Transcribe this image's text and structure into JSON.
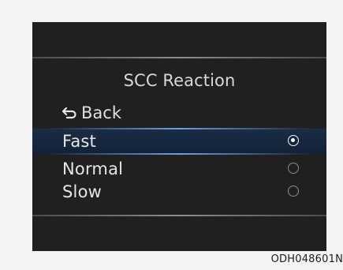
{
  "screen": {
    "title": "SCC Reaction",
    "back_label": "Back",
    "options": [
      {
        "label": "Fast",
        "selected": true
      },
      {
        "label": "Normal",
        "selected": false
      },
      {
        "label": "Slow",
        "selected": false
      }
    ]
  },
  "caption": "ODH048601N",
  "colors": {
    "background": "#202020",
    "selection_band": "#1a2d46",
    "selection_line": "#6f9fe0",
    "text": "#e6e6e6"
  },
  "icons": {
    "back": "back-arrow-icon",
    "radio_selected": "radio-selected-icon",
    "radio_unselected": "radio-unselected-icon"
  }
}
